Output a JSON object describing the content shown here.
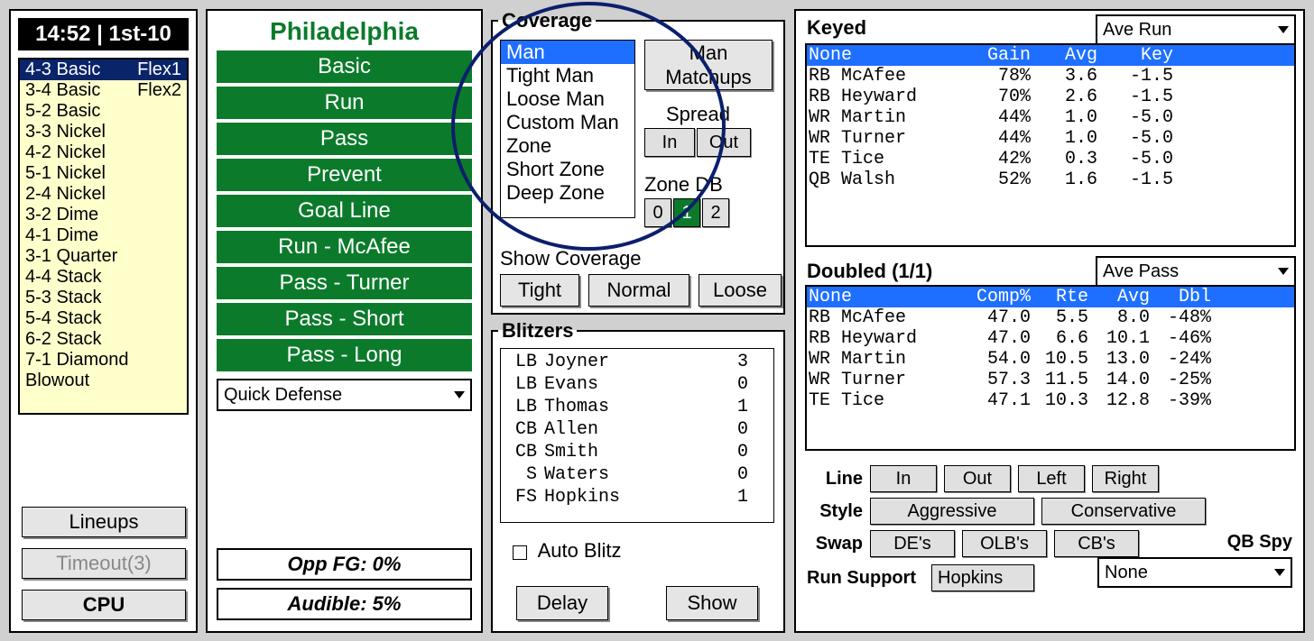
{
  "header": {
    "clock": "14:52 | 1st-10"
  },
  "team": {
    "name": "Philadelphia"
  },
  "formations": [
    {
      "name": "4-3 Basic",
      "extra": "Flex1",
      "selected": true
    },
    {
      "name": "3-4 Basic",
      "extra": "Flex2",
      "selected": false
    },
    {
      "name": "5-2 Basic",
      "extra": "",
      "selected": false
    },
    {
      "name": "3-3 Nickel",
      "extra": "",
      "selected": false
    },
    {
      "name": "4-2 Nickel",
      "extra": "",
      "selected": false
    },
    {
      "name": "5-1 Nickel",
      "extra": "",
      "selected": false
    },
    {
      "name": "2-4 Nickel",
      "extra": "",
      "selected": false
    },
    {
      "name": "3-2 Dime",
      "extra": "",
      "selected": false
    },
    {
      "name": "4-1 Dime",
      "extra": "",
      "selected": false
    },
    {
      "name": "3-1 Quarter",
      "extra": "",
      "selected": false
    },
    {
      "name": "4-4 Stack",
      "extra": "",
      "selected": false
    },
    {
      "name": "5-3 Stack",
      "extra": "",
      "selected": false
    },
    {
      "name": "5-4 Stack",
      "extra": "",
      "selected": false
    },
    {
      "name": "6-2 Stack",
      "extra": "",
      "selected": false
    },
    {
      "name": "7-1 Diamond",
      "extra": "",
      "selected": false
    },
    {
      "name": "Blowout",
      "extra": "",
      "selected": false
    }
  ],
  "left_buttons": {
    "lineups": "Lineups",
    "timeout": "Timeout(3)",
    "cpu": "CPU"
  },
  "plays": [
    "Basic",
    "Run",
    "Pass",
    "Prevent",
    "Goal Line",
    "Run - McAfee",
    "Pass - Turner",
    "Pass - Short",
    "Pass - Long"
  ],
  "quick_defense": {
    "label": "Quick Defense"
  },
  "info": {
    "opp_fg": "Opp FG: 0%",
    "audible": "Audible: 5%"
  },
  "coverage": {
    "legend": "Coverage",
    "options": [
      "Man",
      "Tight Man",
      "Loose Man",
      "Custom Man",
      "Zone",
      "Short Zone",
      "Deep Zone"
    ],
    "selected": "Man",
    "man_matchups": "Man Matchups",
    "spread_label": "Spread",
    "in": "In",
    "out": "Out",
    "zone_db_label": "Zone DB",
    "zdb_0": "0",
    "zdb_1": "1",
    "zdb_2": "2",
    "show_label": "Show Coverage",
    "tight": "Tight",
    "normal": "Normal",
    "loose": "Loose"
  },
  "blitzers": {
    "legend": "Blitzers",
    "rows": [
      {
        "pos": "LB",
        "name": "Joyner",
        "val": "3"
      },
      {
        "pos": "LB",
        "name": "Evans",
        "val": "0"
      },
      {
        "pos": "LB",
        "name": "Thomas",
        "val": "1"
      },
      {
        "pos": "CB",
        "name": "Allen",
        "val": "0"
      },
      {
        "pos": "CB",
        "name": "Smith",
        "val": "0"
      },
      {
        "pos": " S",
        "name": "Waters",
        "val": "0"
      },
      {
        "pos": "FS",
        "name": "Hopkins",
        "val": "1"
      }
    ],
    "auto_blitz": "Auto Blitz",
    "delay": "Delay",
    "show": "Show"
  },
  "keyed": {
    "title": "Keyed",
    "dropdown": "Ave Run",
    "headers": {
      "name": "None",
      "gain": "Gain",
      "avg": "Avg",
      "key": "Key"
    },
    "rows": [
      {
        "name": "RB McAfee",
        "gain": "78%",
        "avg": "3.6",
        "key": "-1.5"
      },
      {
        "name": "RB Heyward",
        "gain": "70%",
        "avg": "2.6",
        "key": "-1.5"
      },
      {
        "name": "WR Martin",
        "gain": "44%",
        "avg": "1.0",
        "key": "-5.0"
      },
      {
        "name": "WR Turner",
        "gain": "44%",
        "avg": "1.0",
        "key": "-5.0"
      },
      {
        "name": "TE Tice",
        "gain": "42%",
        "avg": "0.3",
        "key": "-5.0"
      },
      {
        "name": "QB Walsh",
        "gain": "52%",
        "avg": "1.6",
        "key": "-1.5"
      }
    ]
  },
  "doubled": {
    "title": "Doubled (1/1)",
    "dropdown": "Ave Pass",
    "headers": {
      "name": "None",
      "comp": "Comp%",
      "rte": "Rte",
      "avg": "Avg",
      "dbl": "Dbl"
    },
    "rows": [
      {
        "name": "RB McAfee",
        "comp": "47.0",
        "rte": "5.5",
        "avg": "8.0",
        "dbl": "-48%"
      },
      {
        "name": "RB Heyward",
        "comp": "47.0",
        "rte": "6.6",
        "avg": "10.1",
        "dbl": "-46%"
      },
      {
        "name": "WR Martin",
        "comp": "54.0",
        "rte": "10.5",
        "avg": "13.0",
        "dbl": "-24%"
      },
      {
        "name": "WR Turner",
        "comp": "57.3",
        "rte": "11.5",
        "avg": "14.0",
        "dbl": "-25%"
      },
      {
        "name": "TE Tice",
        "comp": "47.1",
        "rte": "10.3",
        "avg": "12.8",
        "dbl": "-39%"
      }
    ]
  },
  "bottom": {
    "line": "Line",
    "in": "In",
    "out": "Out",
    "left": "Left",
    "right": "Right",
    "style": "Style",
    "aggressive": "Aggressive",
    "conservative": "Conservative",
    "swap": "Swap",
    "des": "DE's",
    "olbs": "OLB's",
    "cbs": "CB's",
    "qbspy_label": "QB Spy",
    "qbspy_value": "None",
    "runsupport_label": "Run Support",
    "runsupport_value": "Hopkins"
  }
}
